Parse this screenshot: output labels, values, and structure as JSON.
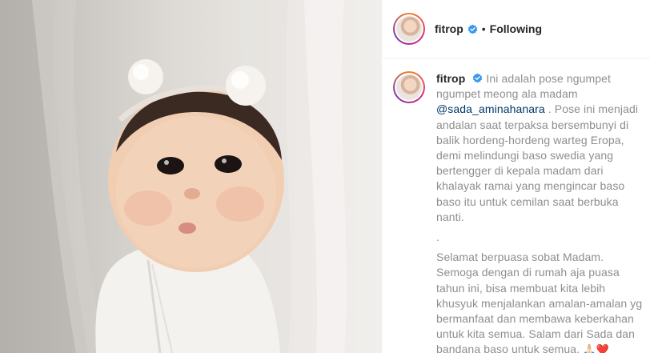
{
  "post": {
    "username": "fitrop",
    "separator": "•",
    "follow_status": "Following",
    "caption": {
      "username": "fitrop",
      "text_before_mention": "Ini adalah pose ngumpet ngumpet meong ala madam",
      "mention": "@sada_aminahanara",
      "text_after_mention": ". Pose ini menjadi andalan saat terpaksa bersembunyi di balik hordeng-hordeng warteg Eropa, demi melindungi baso swedia yang bertengger di kepala madam dari khalayak ramai yang mengincar baso baso itu untuk cemilan saat berbuka nanti.",
      "dot_line": ".",
      "paragraph2": "Selamat berpuasa sobat Madam. Semoga dengan di rumah aja puasa tahun ini, bisa membuat kita lebih khusyuk menjalankan amalan-amalan yg bermanfaat dan membawa keberkahan untuk kita semua. Salam dari Sada dan bandana baso untuk semua.",
      "emojis": "🙏🏻❤️"
    },
    "colors": {
      "verified_badge": "#3897f0",
      "mention": "#00376b"
    }
  }
}
